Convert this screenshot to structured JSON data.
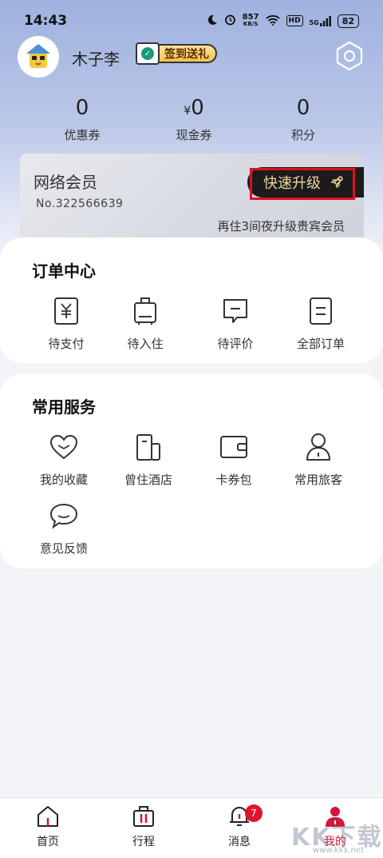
{
  "status_bar": {
    "time": "14:43",
    "net_speed_value": "857",
    "net_speed_unit": "KB/S",
    "hd": "HD",
    "network": "5G",
    "battery": "82"
  },
  "profile": {
    "username": "木子李",
    "signin_label": "签到送礼"
  },
  "stats": [
    {
      "value": "0",
      "prefix": "",
      "label": "优惠券"
    },
    {
      "value": "0",
      "prefix": "¥",
      "label": "现金券"
    },
    {
      "value": "0",
      "prefix": "",
      "label": "积分"
    }
  ],
  "member_card": {
    "title": "网络会员",
    "number": "No.322566639",
    "upgrade_label": "快速升级",
    "hint": "再住3间夜升级贵宾会员"
  },
  "order_center": {
    "title": "订单中心",
    "items": [
      {
        "label": "待支付",
        "icon": "yen-receipt-icon"
      },
      {
        "label": "待入住",
        "icon": "luggage-icon"
      },
      {
        "label": "待评价",
        "icon": "comment-icon"
      },
      {
        "label": "全部订单",
        "icon": "order-list-icon"
      }
    ]
  },
  "services": {
    "title": "常用服务",
    "items": [
      {
        "label": "我的收藏",
        "icon": "heart-icon"
      },
      {
        "label": "曾住酒店",
        "icon": "hotel-icon"
      },
      {
        "label": "卡券包",
        "icon": "wallet-icon"
      },
      {
        "label": "常用旅客",
        "icon": "person-icon"
      },
      {
        "label": "意见反馈",
        "icon": "feedback-icon"
      }
    ]
  },
  "bottom_nav": {
    "items": [
      {
        "label": "首页",
        "icon": "home-icon"
      },
      {
        "label": "行程",
        "icon": "suitcase-icon"
      },
      {
        "label": "消息",
        "icon": "bell-icon",
        "badge": "7"
      },
      {
        "label": "我的",
        "icon": "profile-icon"
      }
    ],
    "active_color": "#d3163c"
  },
  "watermark": {
    "text": "KK下载",
    "url": "www.kkx.net"
  }
}
